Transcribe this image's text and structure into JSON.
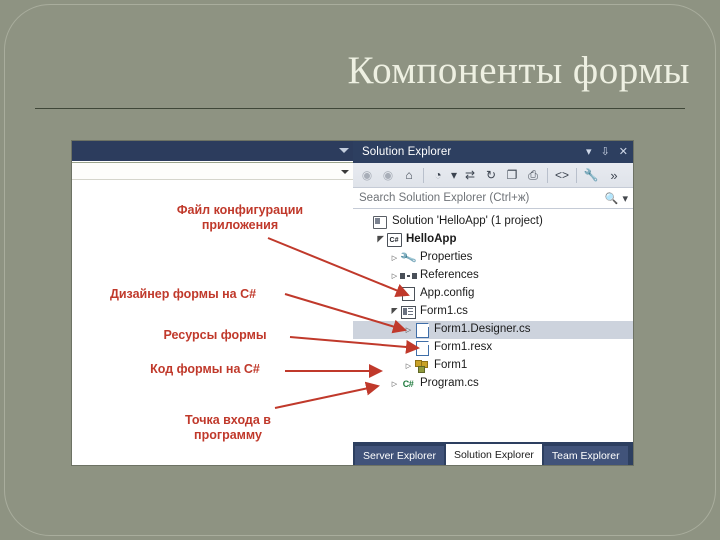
{
  "slide": {
    "title": "Компоненты формы",
    "background_color": "#8e9382",
    "title_color": "#eef0e2",
    "accent_color": "#c0392b"
  },
  "editor_pane": {
    "titlebar_caret": "caret-down-icon",
    "combo_caret": "caret-down-icon",
    "splitter_glyph": "✛",
    "scroll_up_glyph": "▲"
  },
  "solution_explorer": {
    "title": "Solution Explorer",
    "titlebar_buttons": [
      {
        "name": "window-menu-button",
        "glyph": "▾"
      },
      {
        "name": "pin-button",
        "glyph": "⇩"
      },
      {
        "name": "close-button",
        "glyph": "✕"
      }
    ],
    "toolbar": [
      {
        "name": "back-button",
        "glyph": "◉",
        "dim": true
      },
      {
        "name": "forward-button",
        "glyph": "◉",
        "dim": true
      },
      {
        "name": "home-button",
        "glyph": "⌂",
        "dim": false
      },
      {
        "name": "pending-changes-filter-button",
        "glyph": "◔",
        "dim": false
      },
      {
        "name": "filter-dropdown-button",
        "glyph": "▾",
        "dim": false
      },
      {
        "name": "sync-with-active-document-button",
        "glyph": "⇄",
        "dim": false
      },
      {
        "name": "refresh-button",
        "glyph": "↻",
        "dim": false
      },
      {
        "name": "collapse-all-button",
        "glyph": "❐",
        "dim": false
      },
      {
        "name": "show-all-files-button",
        "glyph": "⎙",
        "dim": false
      },
      {
        "name": "view-code-button",
        "glyph": "<>",
        "dim": false
      },
      {
        "name": "properties-button",
        "glyph": "🔧",
        "dim": false
      },
      {
        "name": "overflow-button",
        "glyph": "»",
        "dim": false
      }
    ],
    "search": {
      "placeholder": "Search Solution Explorer (Ctrl+ж)",
      "search_icon": "magnifier-icon",
      "dropdown_icon": "caret-down-icon"
    },
    "tree": [
      {
        "label": "Solution 'HelloApp' (1 project)",
        "indent": 0,
        "twisty": "",
        "icon": "solution-icon",
        "bold": false,
        "selected": false
      },
      {
        "label": "HelloApp",
        "indent": 1,
        "twisty": "▲",
        "icon": "csharp-project-icon",
        "bold": true,
        "selected": false
      },
      {
        "label": "Properties",
        "indent": 2,
        "twisty": "▷",
        "icon": "wrench-icon",
        "bold": false,
        "selected": false
      },
      {
        "label": "References",
        "indent": 2,
        "twisty": "▷",
        "icon": "references-icon",
        "bold": false,
        "selected": false
      },
      {
        "label": "App.config",
        "indent": 2,
        "twisty": "",
        "icon": "config-file-icon",
        "bold": false,
        "selected": false
      },
      {
        "label": "Form1.cs",
        "indent": 2,
        "twisty": "▲",
        "icon": "form-designer-icon",
        "bold": false,
        "selected": false
      },
      {
        "label": "Form1.Designer.cs",
        "indent": 3,
        "twisty": "▷",
        "icon": "code-file-icon",
        "bold": false,
        "selected": true
      },
      {
        "label": "Form1.resx",
        "indent": 3,
        "twisty": "",
        "icon": "code-file-icon",
        "bold": false,
        "selected": false
      },
      {
        "label": "Form1",
        "indent": 3,
        "twisty": "▷",
        "icon": "components-icon",
        "bold": false,
        "selected": false
      },
      {
        "label": "Program.cs",
        "indent": 2,
        "twisty": "▷",
        "icon": "csharp-file-icon",
        "bold": false,
        "selected": false
      }
    ],
    "tabs": [
      {
        "label": "Server Explorer",
        "active": false
      },
      {
        "label": "Solution Explorer",
        "active": true
      },
      {
        "label": "Team Explorer",
        "active": false
      }
    ]
  },
  "annotations": [
    {
      "name": "annotation-app-config",
      "text": "Файл конфигурации\nприложения"
    },
    {
      "name": "annotation-form-designer",
      "text": "Дизайнер формы на C#"
    },
    {
      "name": "annotation-form-resources",
      "text": "Ресурсы формы"
    },
    {
      "name": "annotation-form-code",
      "text": "Код формы на C#"
    },
    {
      "name": "annotation-entry-point",
      "text": "Точка входа в\nпрограмму"
    }
  ]
}
